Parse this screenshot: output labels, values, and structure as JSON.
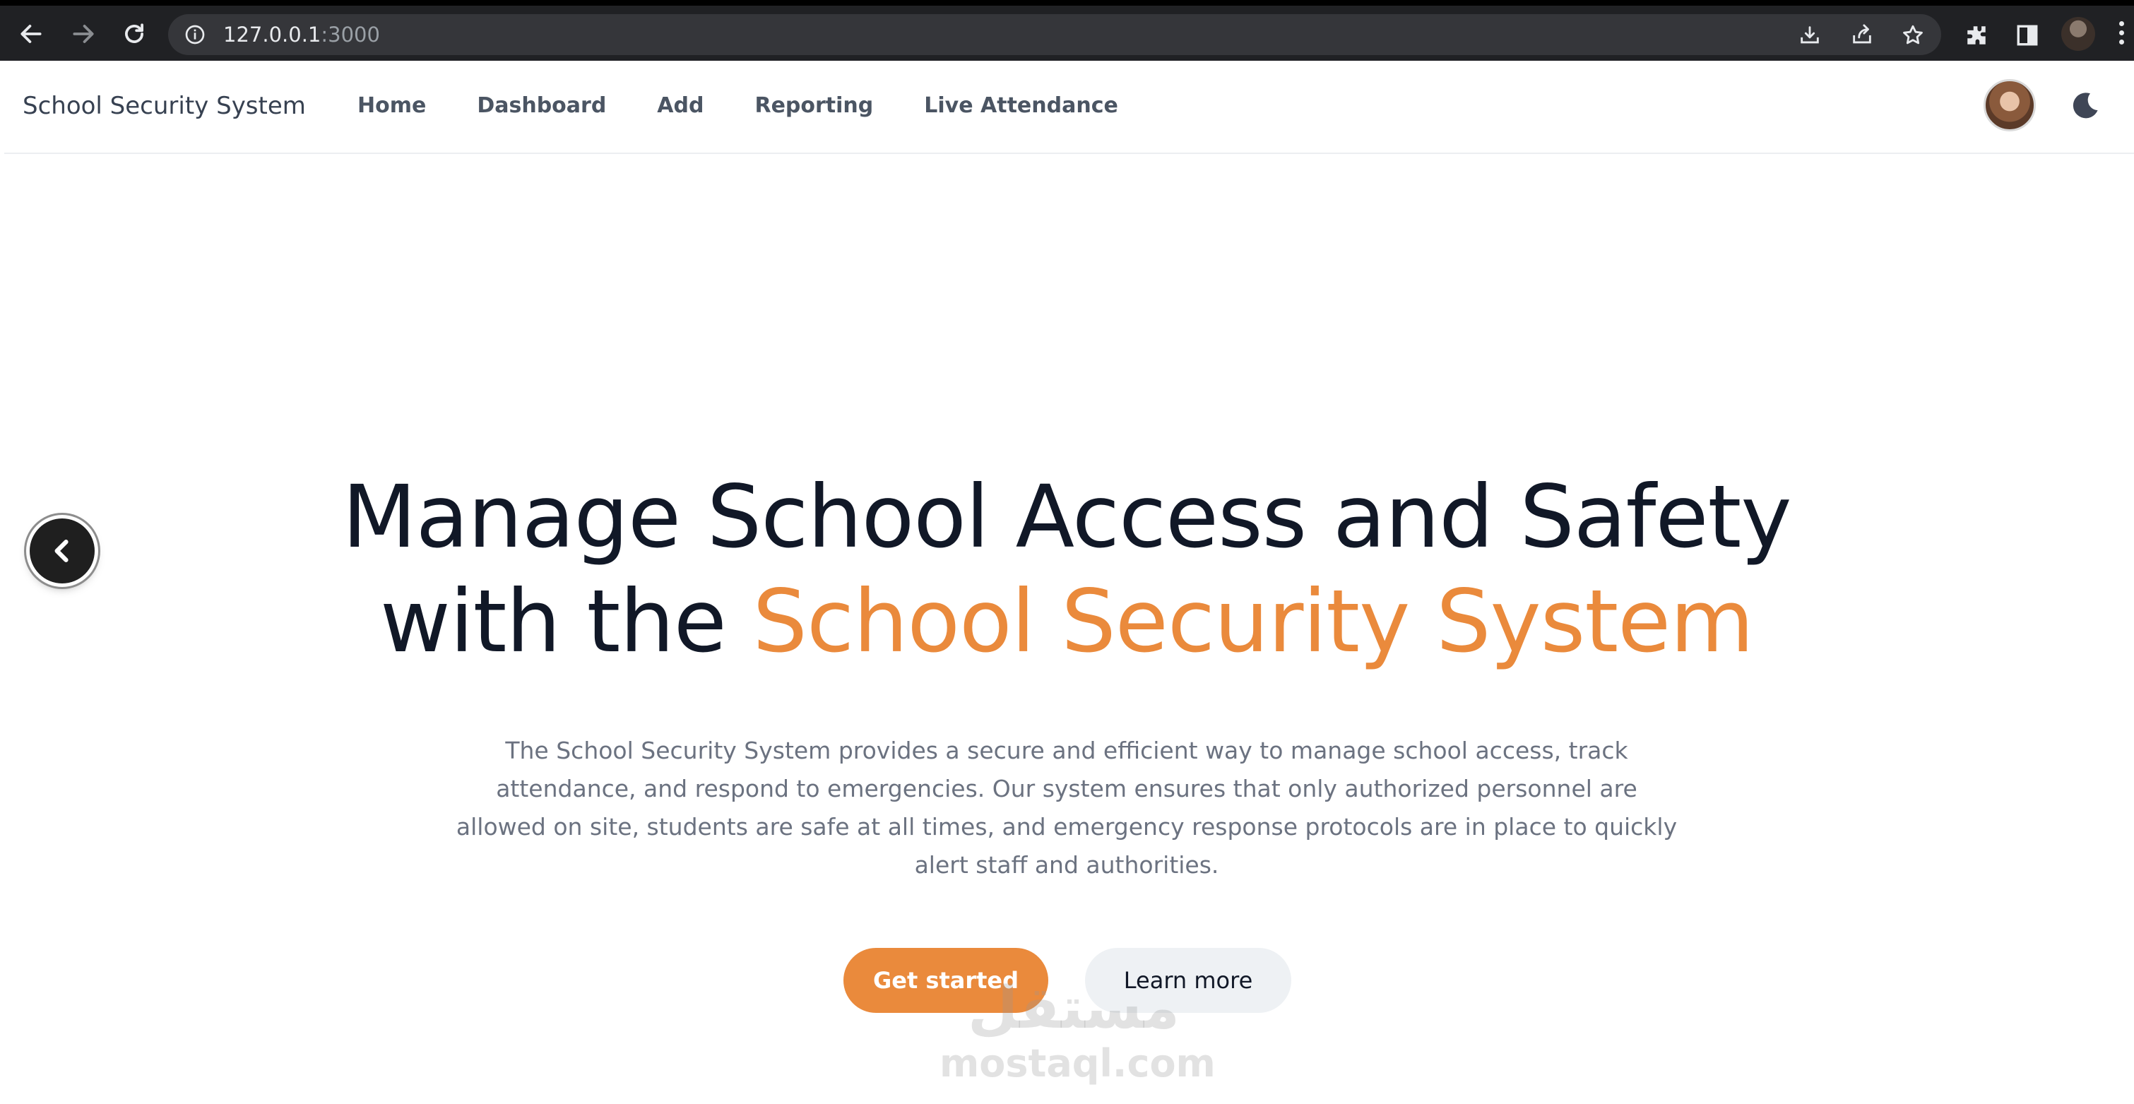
{
  "browser": {
    "url_host": "127.0.0.1",
    "url_port": ":3000",
    "icons": [
      "back-arrow-icon",
      "forward-arrow-icon",
      "reload-icon",
      "info-icon",
      "install-icon",
      "share-icon",
      "star-icon",
      "extensions-icon",
      "side-panel-icon",
      "profile-icon",
      "menu-icon"
    ],
    "colors": {
      "frame": "#202124",
      "omnibox": "#35363a",
      "text": "#e8eaed"
    }
  },
  "site_nav": {
    "brand": "School Security System",
    "links": [
      "Home",
      "Dashboard",
      "Add",
      "Reporting",
      "Live Attendance"
    ]
  },
  "hero": {
    "title_line1": "Manage School Access and Safety",
    "title_prefix": "with the ",
    "title_accent": "School Security System",
    "description": "The School Security System provides a secure and efficient way to manage school access, track attendance, and respond to emergencies. Our system ensures that only authorized personnel are allowed on site, students are safe at all times, and emergency response protocols are in place to quickly alert staff and authorities.",
    "primary_button": "Get started",
    "secondary_button": "Learn more"
  },
  "watermark": {
    "arabic": "مستقل",
    "latin": "mostaql.com"
  },
  "colors": {
    "accent": "#ea8a3c",
    "heading": "#111827",
    "muted_text": "#6b7280",
    "secondary_button_bg": "#eef1f4"
  }
}
